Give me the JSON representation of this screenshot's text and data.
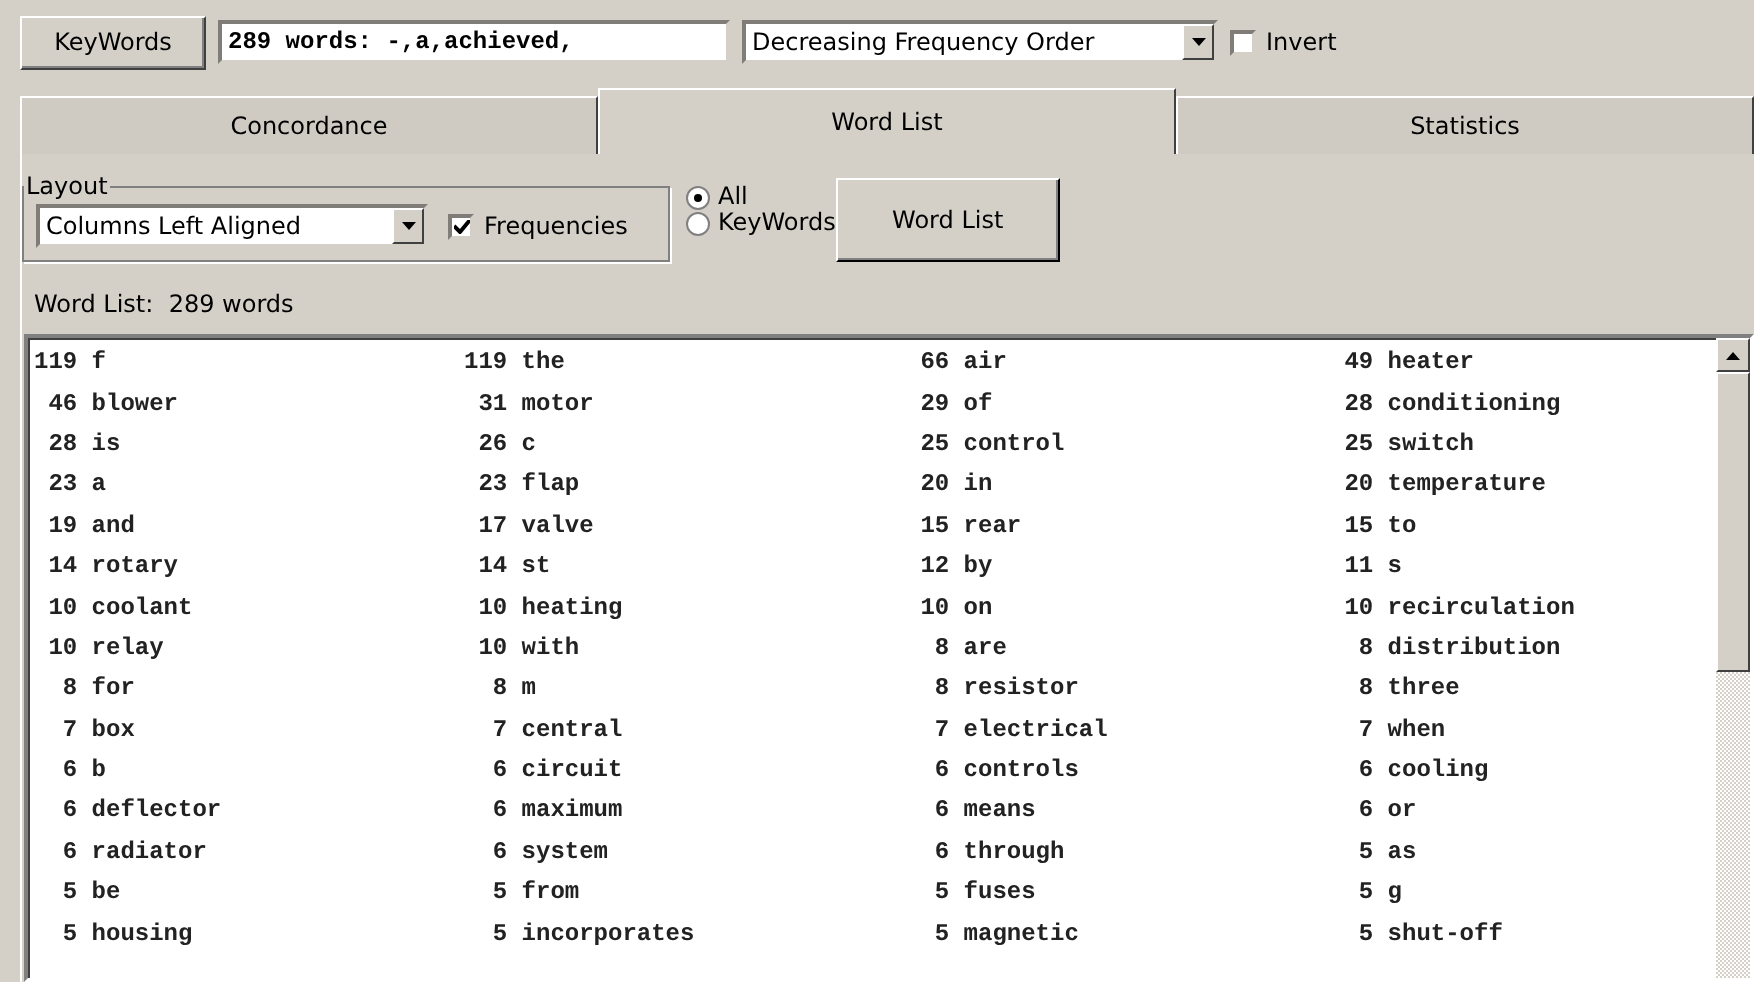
{
  "toolbar": {
    "keywords_button": "KeyWords",
    "keywords_field": "289 words: -,a,achieved,",
    "order_select": "Decreasing Frequency Order",
    "invert": {
      "label": "Invert",
      "checked": false
    }
  },
  "tabs": [
    {
      "label": "Concordance",
      "selected": false
    },
    {
      "label": "Word List",
      "selected": true
    },
    {
      "label": "Statistics",
      "selected": false
    }
  ],
  "layout": {
    "title": "Layout",
    "select": "Columns Left Aligned",
    "frequencies": {
      "label": "Frequencies",
      "checked": true
    }
  },
  "scope": [
    {
      "label": "All",
      "selected": true
    },
    {
      "label": "KeyWords",
      "selected": false
    }
  ],
  "word_list_button": "Word List",
  "summary": {
    "label": "Word List:",
    "value": "289 words"
  },
  "entries": [
    [
      [
        "119",
        "f"
      ],
      [
        "119",
        "the"
      ],
      [
        "66",
        "air"
      ],
      [
        "49",
        "heater"
      ]
    ],
    [
      [
        "46",
        "blower"
      ],
      [
        "31",
        "motor"
      ],
      [
        "29",
        "of"
      ],
      [
        "28",
        "conditioning"
      ]
    ],
    [
      [
        "28",
        "is"
      ],
      [
        "26",
        "c"
      ],
      [
        "25",
        "control"
      ],
      [
        "25",
        "switch"
      ]
    ],
    [
      [
        "23",
        "a"
      ],
      [
        "23",
        "flap"
      ],
      [
        "20",
        "in"
      ],
      [
        "20",
        "temperature"
      ]
    ],
    [
      [
        "19",
        "and"
      ],
      [
        "17",
        "valve"
      ],
      [
        "15",
        "rear"
      ],
      [
        "15",
        "to"
      ]
    ],
    [
      [
        "14",
        "rotary"
      ],
      [
        "14",
        "st"
      ],
      [
        "12",
        "by"
      ],
      [
        "11",
        "s"
      ]
    ],
    [
      [
        "10",
        "coolant"
      ],
      [
        "10",
        "heating"
      ],
      [
        "10",
        "on"
      ],
      [
        "10",
        "recirculation"
      ]
    ],
    [
      [
        "10",
        "relay"
      ],
      [
        "10",
        "with"
      ],
      [
        "8",
        "are"
      ],
      [
        "8",
        "distribution"
      ]
    ],
    [
      [
        "8",
        "for"
      ],
      [
        "8",
        "m"
      ],
      [
        "8",
        "resistor"
      ],
      [
        "8",
        "three"
      ]
    ],
    [
      [
        "7",
        "box"
      ],
      [
        "7",
        "central"
      ],
      [
        "7",
        "electrical"
      ],
      [
        "7",
        "when"
      ]
    ],
    [
      [
        "6",
        "b"
      ],
      [
        "6",
        "circuit"
      ],
      [
        "6",
        "controls"
      ],
      [
        "6",
        "cooling"
      ]
    ],
    [
      [
        "6",
        "deflector"
      ],
      [
        "6",
        "maximum"
      ],
      [
        "6",
        "means"
      ],
      [
        "6",
        "or"
      ]
    ],
    [
      [
        "6",
        "radiator"
      ],
      [
        "6",
        "system"
      ],
      [
        "6",
        "through"
      ],
      [
        "5",
        "as"
      ]
    ],
    [
      [
        "5",
        "be"
      ],
      [
        "5",
        "from"
      ],
      [
        "5",
        "fuses"
      ],
      [
        "5",
        "g"
      ]
    ],
    [
      [
        "5",
        "housing"
      ],
      [
        "5",
        "incorporates"
      ],
      [
        "5",
        "magnetic"
      ],
      [
        "5",
        "shut-off"
      ]
    ]
  ]
}
